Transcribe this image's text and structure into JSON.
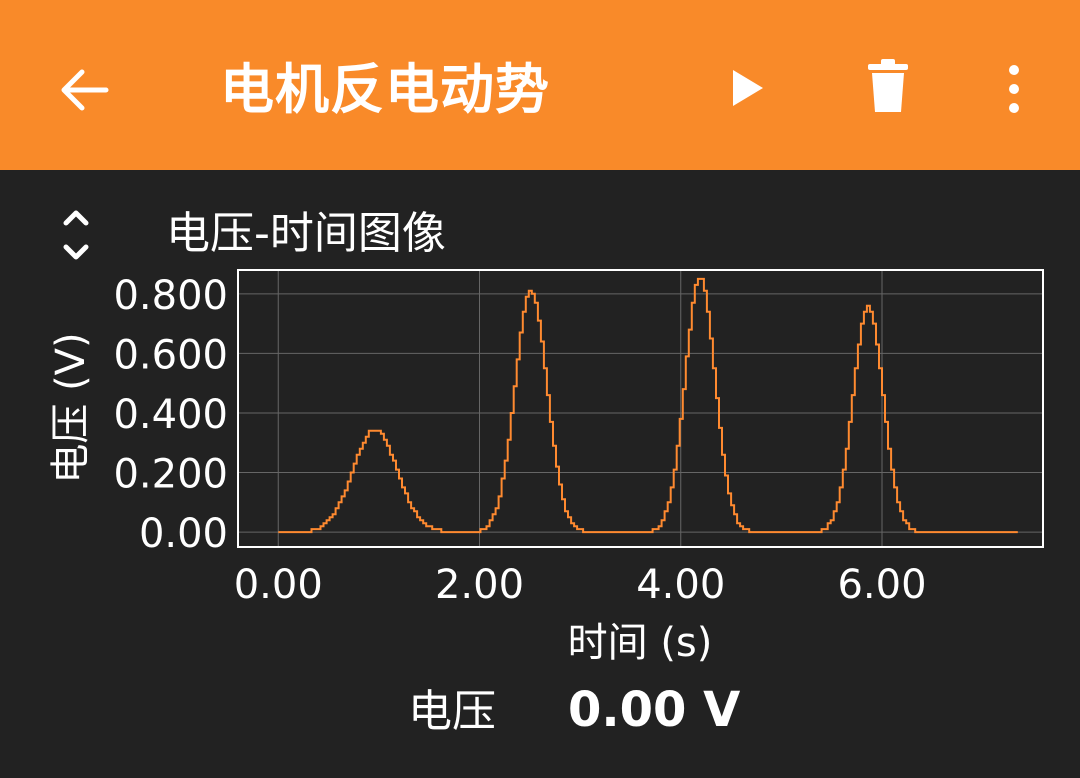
{
  "app": {
    "title": "电机反电动势",
    "icons": [
      "back-arrow-icon",
      "play-icon",
      "trash-icon",
      "more-vert-icon"
    ]
  },
  "colors": {
    "appbar": "#f98a29",
    "background": "#222222",
    "line": "#ff8a30",
    "grid": "#666666"
  },
  "graph": {
    "title": "电压-时间图像",
    "expand_icon": "unfold-icon"
  },
  "chart_data": {
    "type": "line",
    "xlabel": "时间 (s)",
    "ylabel": "电压 (V)",
    "xlim": [
      -0.4,
      7.6
    ],
    "ylim": [
      -0.05,
      0.88
    ],
    "x_ticks": [
      "0.00",
      "2.00",
      "4.00",
      "6.00"
    ],
    "x_tick_values": [
      0,
      2,
      4,
      6
    ],
    "y_ticks": [
      "0.00",
      "0.200",
      "0.400",
      "0.600",
      "0.800"
    ],
    "y_tick_values": [
      0,
      0.2,
      0.4,
      0.6,
      0.8
    ],
    "grid": true,
    "series": [
      {
        "peaks": [
          {
            "t": 0.95,
            "v": 0.345,
            "w": 0.22
          },
          {
            "t": 2.5,
            "v": 0.81,
            "w": 0.16
          },
          {
            "t": 4.18,
            "v": 0.855,
            "w": 0.15
          },
          {
            "t": 5.85,
            "v": 0.755,
            "w": 0.15
          }
        ],
        "x_start": 0.0,
        "x_end": 7.35,
        "step": 0.03
      }
    ]
  },
  "reading": {
    "label": "电压",
    "value": "0.00 V"
  }
}
